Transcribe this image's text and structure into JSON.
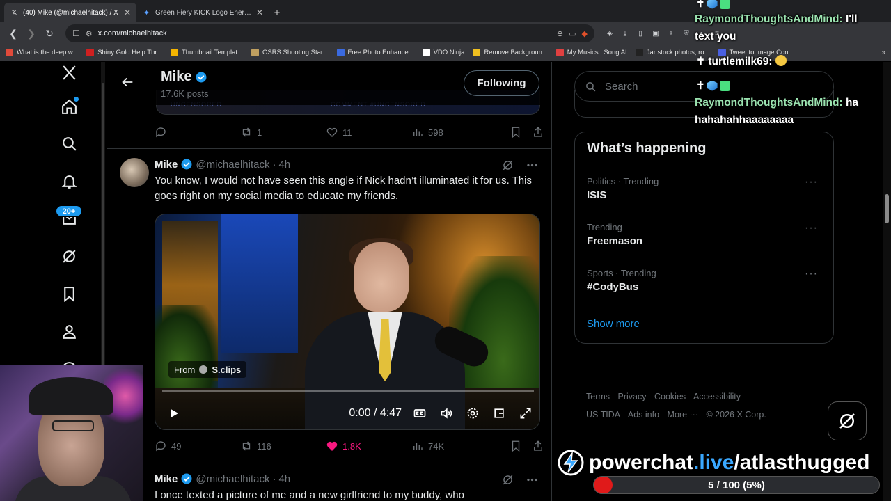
{
  "browser": {
    "tabs": [
      {
        "title": "(40) Mike (@michaelhitack) / X",
        "active": true,
        "icon": "x-logo-icon"
      },
      {
        "title": "Green Fiery KICK Logo Energy - Goog",
        "active": false,
        "icon": "gemini-icon"
      }
    ],
    "url": "x.com/michaelhitack",
    "bookmarks": [
      {
        "label": "What is the deep w...",
        "color": "#e04a3a"
      },
      {
        "label": "Shiny Gold Help Thr...",
        "color": "#d02020"
      },
      {
        "label": "Thumbnail Templat...",
        "color": "#f4b400"
      },
      {
        "label": "OSRS Shooting Star...",
        "color": "#c0a060"
      },
      {
        "label": "Free Photo Enhance...",
        "color": "#3a6ae0"
      },
      {
        "label": "VDO.Ninja",
        "color": "#ffffff"
      },
      {
        "label": "Remove Backgroun...",
        "color": "#f0c020"
      },
      {
        "label": "My Musics | Song AI",
        "color": "#e04040"
      },
      {
        "label": "Jar stock photos, ro...",
        "color": "#222222"
      },
      {
        "label": "Tweet to Image Con...",
        "color": "#4a60e0"
      }
    ]
  },
  "profile": {
    "name": "Mike",
    "posts": "17.6K posts",
    "follow_label": "Following"
  },
  "prev_post": {
    "media_text_1": "UNCENSORED",
    "media_text_2": "COMMENT #UNCENSORED",
    "replies": "",
    "reposts": "1",
    "likes": "11",
    "views": "598"
  },
  "tweet1": {
    "name": "Mike",
    "handle": "@michaelhitack",
    "sep": "·",
    "age": "4h",
    "text": "You know, I would not have seen this angle if Nick hadn’t illuminated it for us. This goes right on my social media to educate my friends.",
    "video": {
      "from_label": "From",
      "source": "S.clips",
      "time": "0:00 / 4:47"
    },
    "replies": "49",
    "reposts": "116",
    "likes": "1.8K",
    "views": "74K"
  },
  "tweet2": {
    "name": "Mike",
    "handle": "@michaelhitack",
    "sep": "·",
    "age": "4h",
    "text": "I once texted a picture of me and a new girlfriend to my buddy, who"
  },
  "nav": {
    "notifications_badge": "20+"
  },
  "sidebar": {
    "search_placeholder": "Search",
    "trends_title": "What’s happening",
    "trends": [
      {
        "context": "Politics · Trending",
        "name": "ISIS"
      },
      {
        "context": "Trending",
        "name": "Freemason"
      },
      {
        "context": "Sports · Trending",
        "name": "#CodyBus"
      }
    ],
    "show_more": "Show more",
    "footer": {
      "terms": "Terms",
      "privacy": "Privacy",
      "cookies": "Cookies",
      "accessibility": "Accessibility",
      "tida": "US TIDA",
      "ads": "Ads info",
      "more": "More ···",
      "copyright": "© 2026 X Corp."
    }
  },
  "chat_overlay": {
    "messages": [
      {
        "user": "RaymondThoughtsAndMind:",
        "text": "I'll",
        "text2": "text you"
      },
      {
        "user": "turtlemilk69:",
        "text": ""
      },
      {
        "user": "RaymondThoughtsAndMind:",
        "text": "ha",
        "text2": "hahahahhaaaaaaaa"
      }
    ],
    "separator": ":"
  },
  "powerchat": {
    "brand": "powerchat",
    "dot": ".live",
    "path": "/atlasthugged",
    "progress_text": "5 / 100 (5%)",
    "progress": 0.05
  },
  "colors": {
    "accent": "#1d9bf0",
    "like": "#f91880",
    "chat_user": "#9be3b0"
  }
}
